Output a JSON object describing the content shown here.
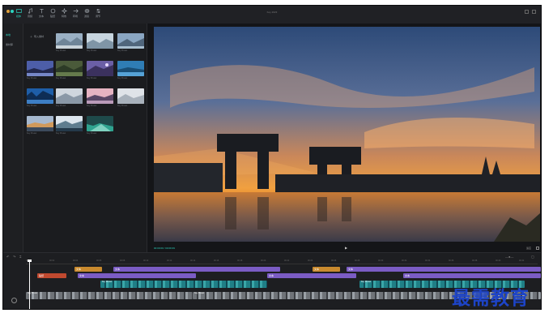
{
  "window": {
    "title": "Key 2023",
    "accent": "#2dd4bf"
  },
  "toolbar": {
    "tools": [
      {
        "label": "媒体",
        "icon": "media-icon",
        "active": true
      },
      {
        "label": "音频",
        "icon": "music-icon"
      },
      {
        "label": "文本",
        "icon": "text-icon"
      },
      {
        "label": "贴纸",
        "icon": "sticker-icon"
      },
      {
        "label": "特效",
        "icon": "effects-icon"
      },
      {
        "label": "转场",
        "icon": "transition-icon"
      },
      {
        "label": "滤镜",
        "icon": "filter-icon"
      },
      {
        "label": "调节",
        "icon": "adjust-icon"
      }
    ]
  },
  "sidebar": {
    "items": [
      {
        "label": "本地",
        "active": true
      },
      {
        "label": "素材库"
      }
    ]
  },
  "media": {
    "import_label": "导入素材",
    "thumbs": [
      {
        "caption": "Key Preset"
      },
      {
        "caption": "Key Preset"
      },
      {
        "caption": "Key Preset"
      },
      {
        "caption": "Key Preset"
      },
      {
        "caption": "Key Preset"
      },
      {
        "caption": "Key Preset"
      },
      {
        "caption": "Key Preset"
      },
      {
        "caption": "Key Preset"
      },
      {
        "caption": "Key Preset"
      },
      {
        "caption": "Key Preset"
      },
      {
        "caption": "Key Preset"
      },
      {
        "caption": "Key Preset"
      },
      {
        "caption": "Key Preset"
      },
      {
        "caption": "Key Preset"
      },
      {
        "caption": "Key Preset"
      }
    ]
  },
  "preview": {
    "timecode": "00:00:00 / 00:09:39",
    "ratio": "适应"
  },
  "timeline": {
    "ticks": [
      "00:00",
      "00:02",
      "00:04",
      "00:06",
      "00:08",
      "00:10",
      "00:12",
      "00:14",
      "00:16",
      "00:18",
      "00:20",
      "00:22",
      "00:24",
      "00:26",
      "00:28",
      "00:30",
      "00:32",
      "00:34",
      "00:36",
      "00:38",
      "00:40",
      "00:42"
    ],
    "clips": [
      {
        "label": "文本",
        "color": "#c98a2e"
      },
      {
        "label": "文本",
        "color": "#7b5cc4"
      },
      {
        "label": "文本",
        "color": "#c98a2e"
      },
      {
        "label": "文本",
        "color": "#7b5cc4"
      },
      {
        "label": "贴纸",
        "color": "#c0492f"
      },
      {
        "label": "文本",
        "color": "#7b5cc4"
      },
      {
        "label": "文本",
        "color": "#7b5cc4"
      },
      {
        "label": "文本",
        "color": "#7b5cc4"
      }
    ],
    "films": [
      {
        "label": "Key Preset"
      },
      {
        "label": "Key Preset"
      },
      {
        "label": "Key Preset"
      },
      {
        "label": "Key Preset"
      }
    ]
  },
  "watermark": {
    "text": "最需教育",
    "color": "#1d44c8"
  }
}
